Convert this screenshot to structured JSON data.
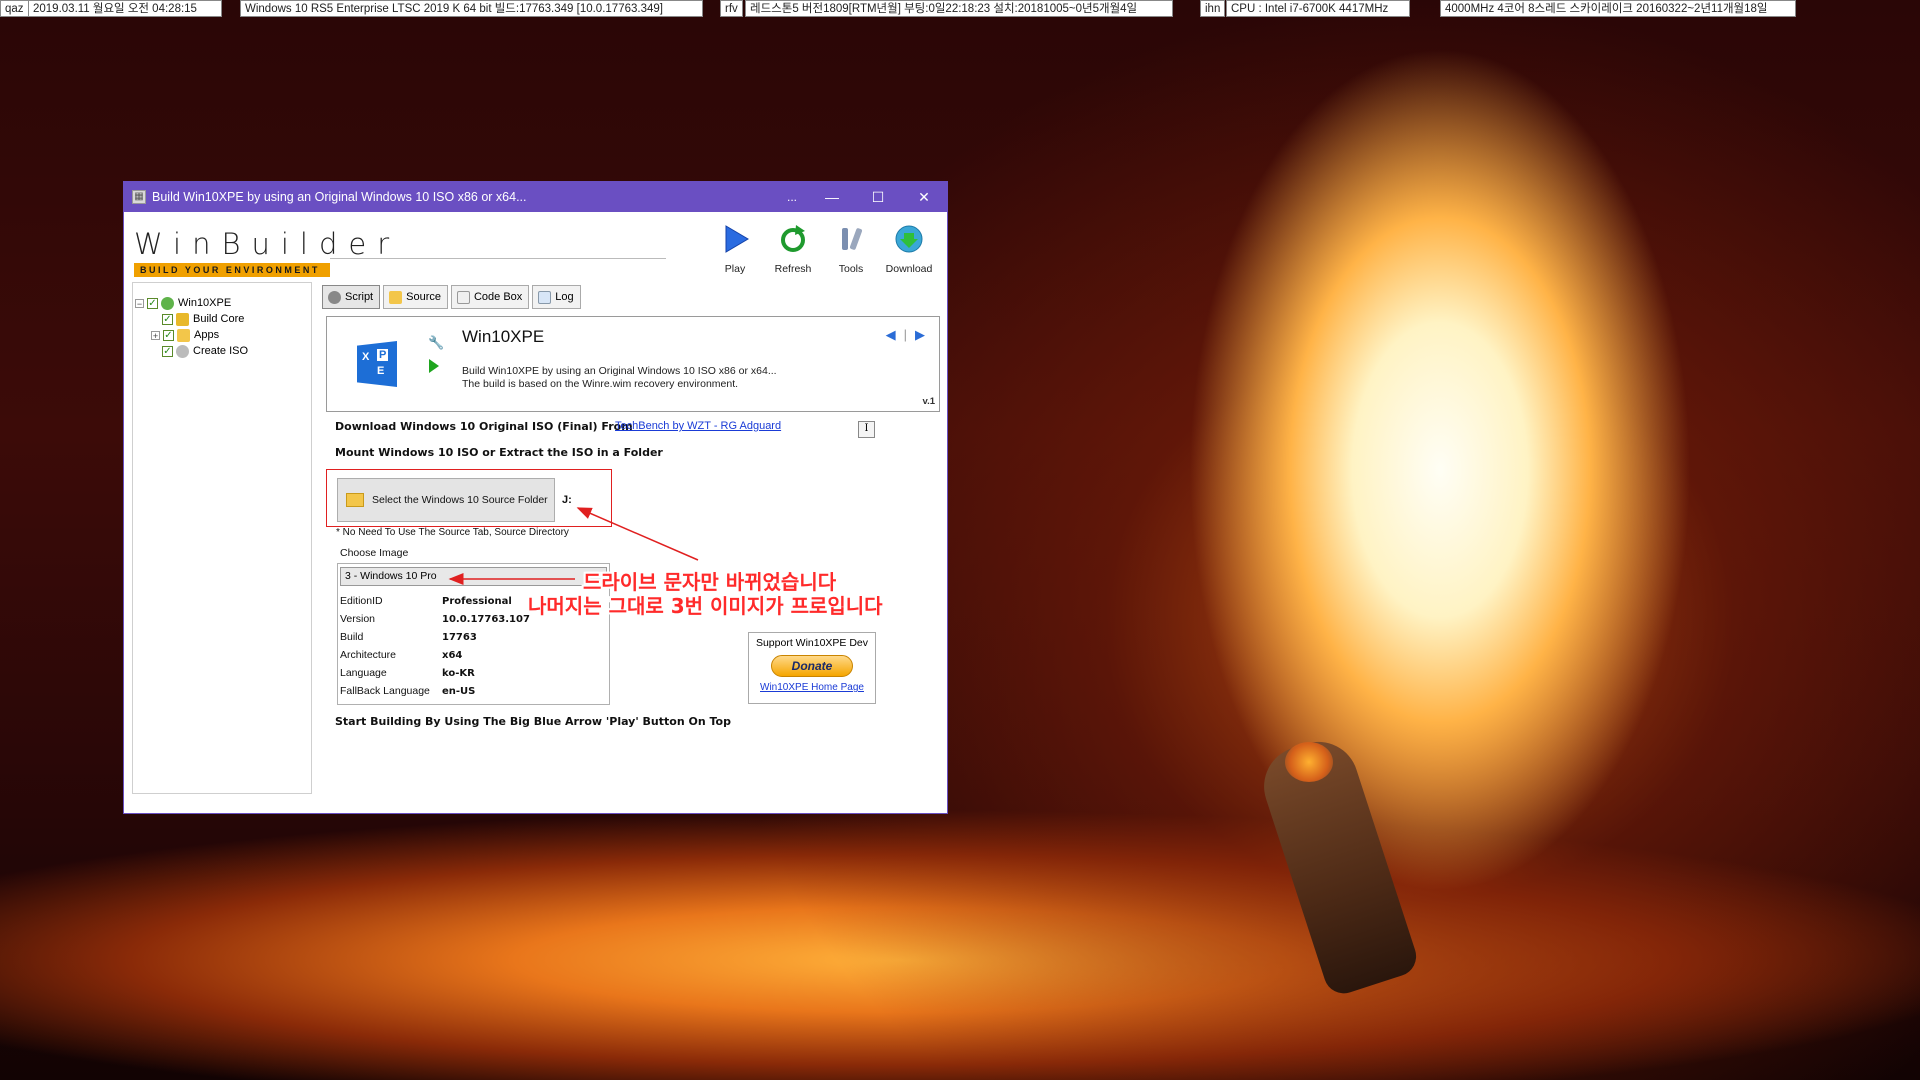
{
  "statusbar": {
    "items": [
      {
        "key": "qaz",
        "value": "2019.03.11 월요일 오전 04:28:15"
      },
      {
        "key": "",
        "value": "Windows 10 RS5 Enterprise LTSC 2019 K 64 bit 빌드:17763.349 [10.0.17763.349]"
      },
      {
        "key": "rfv",
        "value": "레드스톤5 버전1809[RTM년월] 부팅:0일22:18:23 설치:20181005~0년5개월4일"
      },
      {
        "key": "ihn",
        "value": "CPU : Intel i7-6700K 4417MHz"
      },
      {
        "key": "",
        "value": "4000MHz 4코어 8스레드 스카이레이크 20160322~2년11개월18일"
      }
    ]
  },
  "window": {
    "title": "Build Win10XPE by using an Original Windows 10 ISO x86 or x64...",
    "dots": "...",
    "minimize": "—",
    "maximize": "☐",
    "close": "✕"
  },
  "logo": {
    "name": "WinBuilder",
    "tagline": "BUILD YOUR ENVIRONMENT"
  },
  "toolbar": [
    {
      "label": "Play",
      "icon": "play-icon"
    },
    {
      "label": "Refresh",
      "icon": "refresh-icon"
    },
    {
      "label": "Tools",
      "icon": "tools-icon"
    },
    {
      "label": "Download",
      "icon": "download-icon"
    }
  ],
  "tree": {
    "root": "Win10XPE",
    "items": [
      "Build Core",
      "Apps",
      "Create ISO"
    ]
  },
  "tabs": [
    "Script",
    "Source",
    "Code Box",
    "Log"
  ],
  "script": {
    "title": "Win10XPE",
    "desc_line1": "Build Win10XPE by using an Original Windows 10 ISO x86 or x64...",
    "desc_line2": "The build is based on the Winre.wim recovery environment.",
    "version": "v.1",
    "logo_letters": [
      "X",
      "P",
      "E"
    ]
  },
  "content": {
    "download_label": "Download Windows 10 Original ISO (Final) From",
    "download_link": "TechBench by WZT - RG Adguard",
    "info_btn": "I",
    "mount_label": "Mount Windows 10 ISO or Extract the ISO in a Folder",
    "select_button": "Select the Windows 10 Source Folder",
    "drive_letter": "J:",
    "note": "* No Need To Use The Source Tab, Source Directory",
    "choose_image": "Choose Image",
    "selected_image": "3 - Windows 10 Pro",
    "fields": [
      {
        "k": "EditionID",
        "v": "Professional"
      },
      {
        "k": "Version",
        "v": "10.0.17763.107"
      },
      {
        "k": "Build",
        "v": "17763"
      },
      {
        "k": "Architecture",
        "v": "x64"
      },
      {
        "k": "Language",
        "v": "ko-KR"
      },
      {
        "k": "FallBack Language",
        "v": "en-US"
      }
    ],
    "start_label": "Start Building By Using The Big Blue Arrow 'Play' Button On Top",
    "support_title": "Support Win10XPE Dev",
    "donate": "Donate",
    "home_link": "Win10XPE Home Page"
  },
  "annotations": {
    "line1": "드라이브 문자만 바뀌었습니다",
    "line2": "나머지는 그대로 3번 이미지가 프로입니다"
  },
  "colors": {
    "titlebar": "#6a4fc2",
    "accent_red": "#e02020",
    "link": "#1a3bd6",
    "logo_bar": "#f0a000"
  }
}
